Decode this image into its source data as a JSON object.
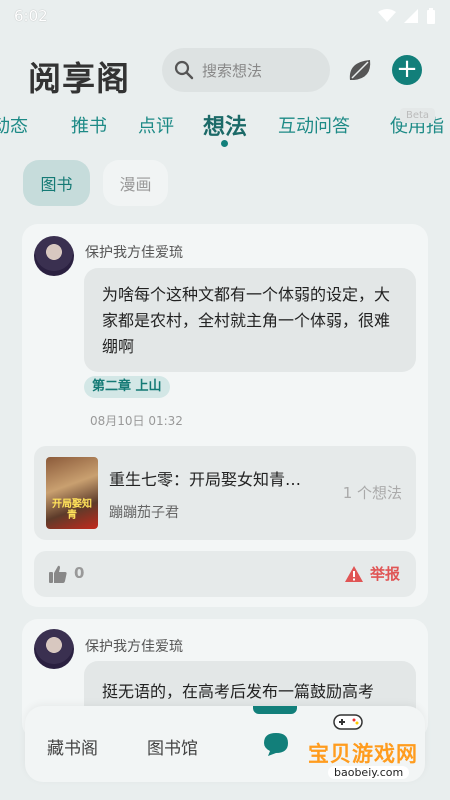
{
  "status": {
    "time": "6:02"
  },
  "app": {
    "title": "阅享阁"
  },
  "search": {
    "placeholder": "搜索想法"
  },
  "tabs": [
    {
      "label": "动态"
    },
    {
      "label": "推书"
    },
    {
      "label": "点评"
    },
    {
      "label": "想法"
    },
    {
      "label": "互动问答"
    },
    {
      "label": "使用指"
    }
  ],
  "beta_label": "Beta",
  "categories": [
    {
      "label": "图书"
    },
    {
      "label": "漫画"
    }
  ],
  "posts": [
    {
      "user": "保护我方佳爱琉",
      "content": "为啥每个这种文都有一个体弱的设定，大家都是农村，全村就主角一个体弱，很难绷啊",
      "chapter": "第二章 上山",
      "date": "08月10日 01:32",
      "book": {
        "title": "重生七零：开局娶女知青…",
        "author": "蹦蹦茄子君",
        "count": "1 个想法",
        "cover_text": "开局娶知青"
      },
      "likes": "0",
      "report_label": "举报"
    },
    {
      "user": "保护我方佳爱琉",
      "content": "挺无语的，在高考后发布一篇鼓励高考"
    }
  ],
  "nav": {
    "items": [
      {
        "label": "藏书阁"
      },
      {
        "label": "图书馆"
      }
    ]
  },
  "watermark": {
    "text": "宝贝游戏网",
    "url": "baobeiy.com"
  },
  "colors": {
    "accent": "#127f7a",
    "danger": "#e05555"
  }
}
